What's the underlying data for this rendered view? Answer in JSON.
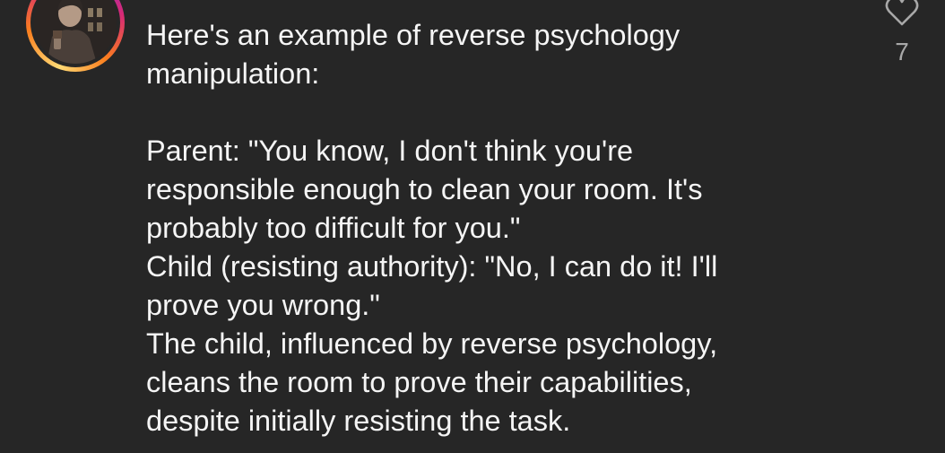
{
  "comment": {
    "avatar_icon": "user-avatar-anime-character",
    "text": "Here's an example of reverse psychology\nmanipulation:\n\nParent: \"You know, I don't think you're\nresponsible enough to clean your room. It's\nprobably too difficult for you.\"\nChild (resisting authority): \"No, I can do it! I'll\nprove you wrong.\"\nThe child, influenced by reverse psychology,\ncleans the room to prove their capabilities,\ndespite initially resisting the task."
  },
  "like": {
    "icon": "heart-icon",
    "count": "7"
  },
  "colors": {
    "background": "#262626",
    "text": "#f5f5f5",
    "secondary_text": "#a8a8a8",
    "story_ring": [
      "#feda75",
      "#fa7e1e",
      "#d62976",
      "#962fbf"
    ]
  }
}
